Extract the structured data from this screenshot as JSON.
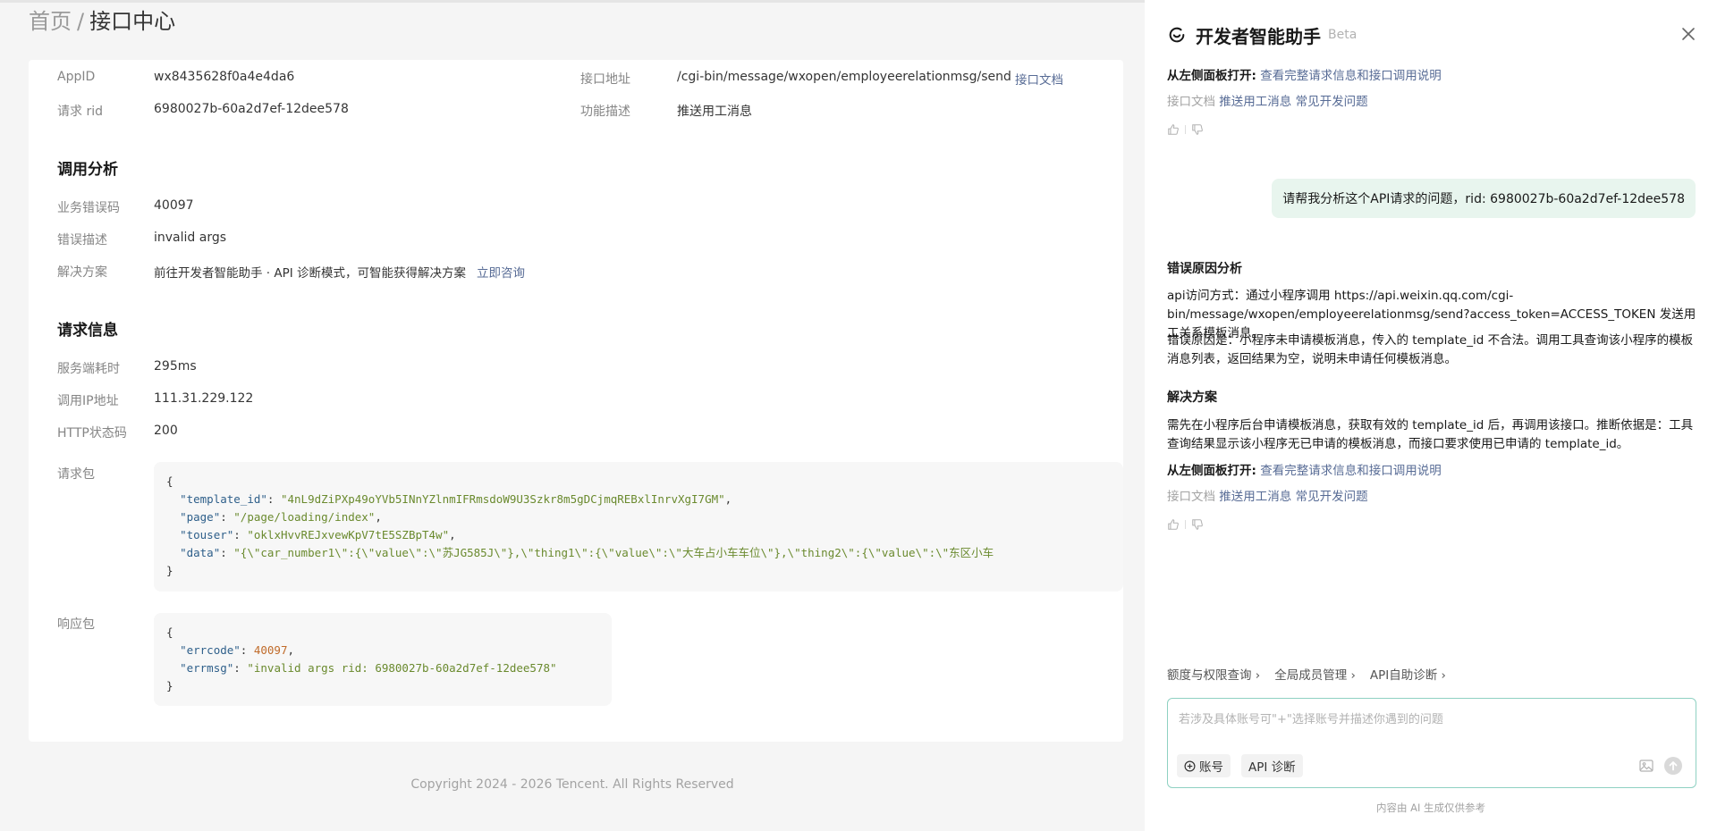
{
  "breadcrumb": {
    "home": "首页",
    "separator": "/",
    "current": "接口中心"
  },
  "basic": {
    "appid_label": "AppID",
    "appid_value": "wx8435628f0a4e4da6",
    "rid_label": "请求 rid",
    "rid_value": "6980027b-60a2d7ef-12dee578",
    "api_addr_label": "接口地址",
    "api_addr_value": "/cgi-bin/message/wxopen/employeerelationmsg/send",
    "api_doc_link": "接口文档",
    "func_label": "功能描述",
    "func_value": "推送用工消息"
  },
  "analysis": {
    "title": "调用分析",
    "errcode_label": "业务错误码",
    "errcode_value": "40097",
    "errdesc_label": "错误描述",
    "errdesc_value": "invalid args",
    "solution_label": "解决方案",
    "solution_value": "前往开发者智能助手 · API 诊断模式，可智能获得解决方案",
    "solution_link": "立即咨询"
  },
  "request": {
    "title": "请求信息",
    "cost_label": "服务端耗时",
    "cost_value": "295ms",
    "ip_label": "调用IP地址",
    "ip_value": "111.31.229.122",
    "http_label": "HTTP状态码",
    "http_value": "200",
    "req_label": "请求包",
    "req_template_id_key": "\"template_id\"",
    "req_template_id_val": "\"4nL9dZiPXp49oYVb5INnYZlnmIFRmsdoW9U3Szkr8m5gDCjmqREBxlInrvXgI7GM\"",
    "req_page_key": "\"page\"",
    "req_page_val": "\"/page/loading/index\"",
    "req_touser_key": "\"touser\"",
    "req_touser_val": "\"oklxHvvREJxvewKpV7tE5SZBpT4w\"",
    "req_data_key": "\"data\"",
    "req_data_val": "\"{\\\"car_number1\\\":{\\\"value\\\":\\\"苏JG585J\\\"},\\\"thing1\\\":{\\\"value\\\":\\\"大车占小车车位\\\"},\\\"thing2\\\":{\\\"value\\\":\\\"东区小车",
    "resp_label": "响应包",
    "resp_errcode_key": "\"errcode\"",
    "resp_errcode_val": "40097",
    "resp_errmsg_key": "\"errmsg\"",
    "resp_errmsg_val": "\"invalid args rid: 6980027b-60a2d7ef-12dee578\""
  },
  "footer": "Copyright 2024 - 2026 Tencent. All Rights Reserved",
  "assistant": {
    "title": "开发者智能助手",
    "badge": "Beta",
    "top_open_label": "从左侧面板打开:",
    "top_open_link": "查看完整请求信息和接口调用说明",
    "top_doc_label": "接口文档",
    "top_doc_link1": "推送用工消息",
    "top_doc_link2": "常见开发问题",
    "user_message": "请帮我分析这个API请求的问题，rid: 6980027b-60a2d7ef-12dee578",
    "cause_title": "错误原因分析",
    "cause_p1": "api访问方式：通过小程序调用 https://api.weixin.qq.com/cgi-bin/message/wxopen/employeerelationmsg/send?access_token=ACCESS_TOKEN 发送用工关系模板消息。",
    "cause_p2": "错误原因是：小程序未申请模板消息，传入的 template_id 不合法。调用工具查询该小程序的模板消息列表，返回结果为空，说明未申请任何模板消息。",
    "solution_title": "解决方案",
    "solution_p": "需先在小程序后台申请模板消息，获取有效的 template_id 后，再调用该接口。推断依据是：工具查询结果显示该小程序无已申请的模板消息，而接口要求使用已申请的 template_id。",
    "bottom_open_label": "从左侧面板打开:",
    "bottom_open_link": "查看完整请求信息和接口调用说明",
    "bottom_doc_label": "接口文档",
    "bottom_doc_link1": "推送用工消息",
    "bottom_doc_link2": "常见开发问题",
    "quick_actions": [
      "额度与权限查询",
      "全局成员管理",
      "API自助诊断"
    ],
    "input_placeholder": "若涉及具体账号可\"+\"选择账号并描述你遇到的问题",
    "chip_account": "账号",
    "chip_api": "API 诊断",
    "disclaimer": "内容由 AI 生成仅供参考"
  },
  "colors": {
    "link": "#576b95",
    "bubble": "#e8f5ee",
    "input_border": "#8fd1c2"
  }
}
